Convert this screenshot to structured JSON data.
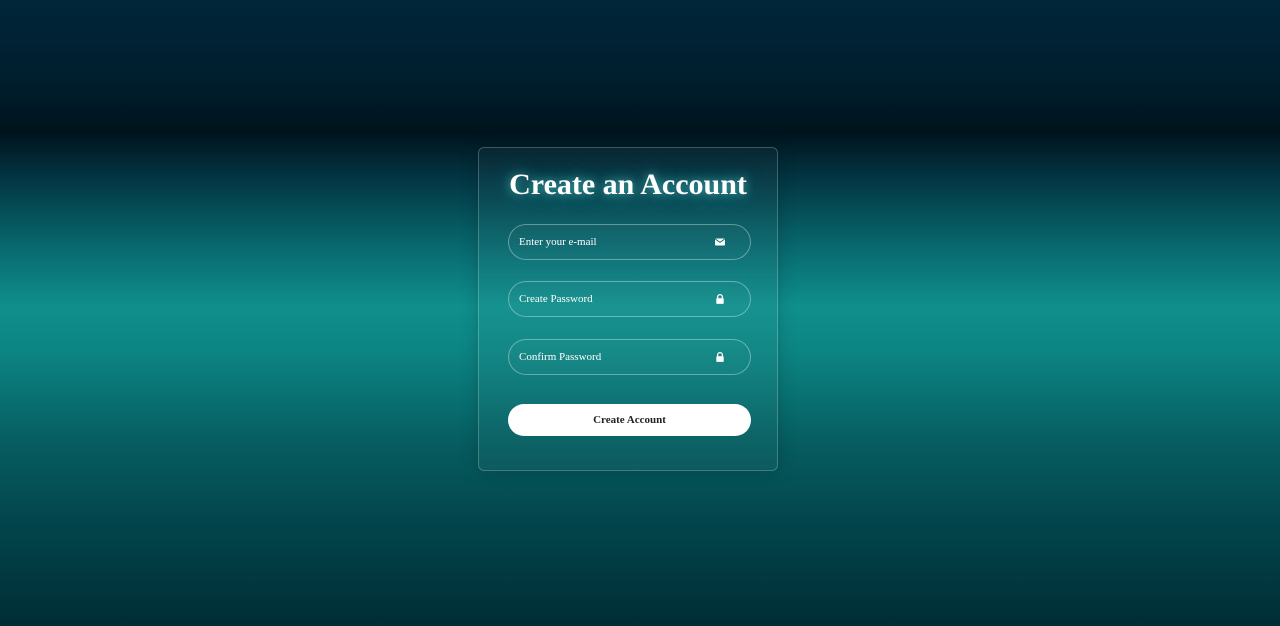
{
  "form": {
    "title": "Create an Account",
    "fields": [
      {
        "name": "email",
        "placeholder": "Enter your e-mail",
        "value": "",
        "icon": "envelope-icon"
      },
      {
        "name": "password",
        "placeholder": "Create Password",
        "value": "",
        "icon": "lock-icon"
      },
      {
        "name": "confirm_password",
        "placeholder": "Confirm Password",
        "value": "",
        "icon": "lock-icon"
      }
    ],
    "submit_label": "Create Account"
  },
  "colors": {
    "card_border": "#ffffff38",
    "button_bg": "#ffffff",
    "button_text": "#222222",
    "accent_glow": "#78ffff",
    "background_teal": "#0f8f8d",
    "background_dark": "#00131d"
  }
}
